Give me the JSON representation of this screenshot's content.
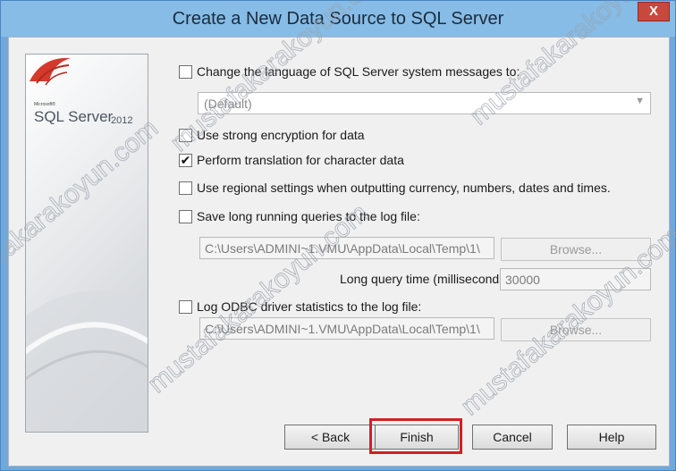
{
  "window": {
    "title": "Create a New Data Source to SQL Server",
    "close_glyph": "X"
  },
  "side_panel": {
    "logo_icon": "sql-server-logo-icon",
    "logo_small_text": "Microsoft®",
    "product": "SQL Server",
    "version": "2012"
  },
  "options": {
    "change_language": {
      "label": "Change the language of SQL Server system messages to:",
      "checked": false
    },
    "language_combo": {
      "value": "(Default)",
      "icon": "chevron-down-icon"
    },
    "strong_encryption": {
      "label": "Use strong encryption for data",
      "checked": false
    },
    "translation": {
      "label": "Perform translation for character data",
      "checked": true
    },
    "regional": {
      "label": "Use regional settings when outputting currency, numbers, dates and times.",
      "checked": false
    },
    "long_queries": {
      "label": "Save long running queries to the log file:",
      "checked": false
    },
    "long_queries_path": "C:\\Users\\ADMINI~1.VMU\\AppData\\Local\\Temp\\1\\",
    "long_queries_browse": "Browse...",
    "query_time_label": "Long query time (milliseconds):",
    "query_time_value": "30000",
    "log_odbc": {
      "label": "Log ODBC driver statistics to the log file:",
      "checked": false
    },
    "log_odbc_path": "C:\\Users\\ADMINI~1.VMU\\AppData\\Local\\Temp\\1\\",
    "log_odbc_browse": "Browse..."
  },
  "footer": {
    "back": "< Back",
    "finish": "Finish",
    "cancel": "Cancel",
    "help": "Help"
  },
  "watermark_text": "mustafakarakoyun.com",
  "colors": {
    "titlebar": "#86bce6",
    "close": "#c7483c",
    "highlight": "#d02025"
  }
}
